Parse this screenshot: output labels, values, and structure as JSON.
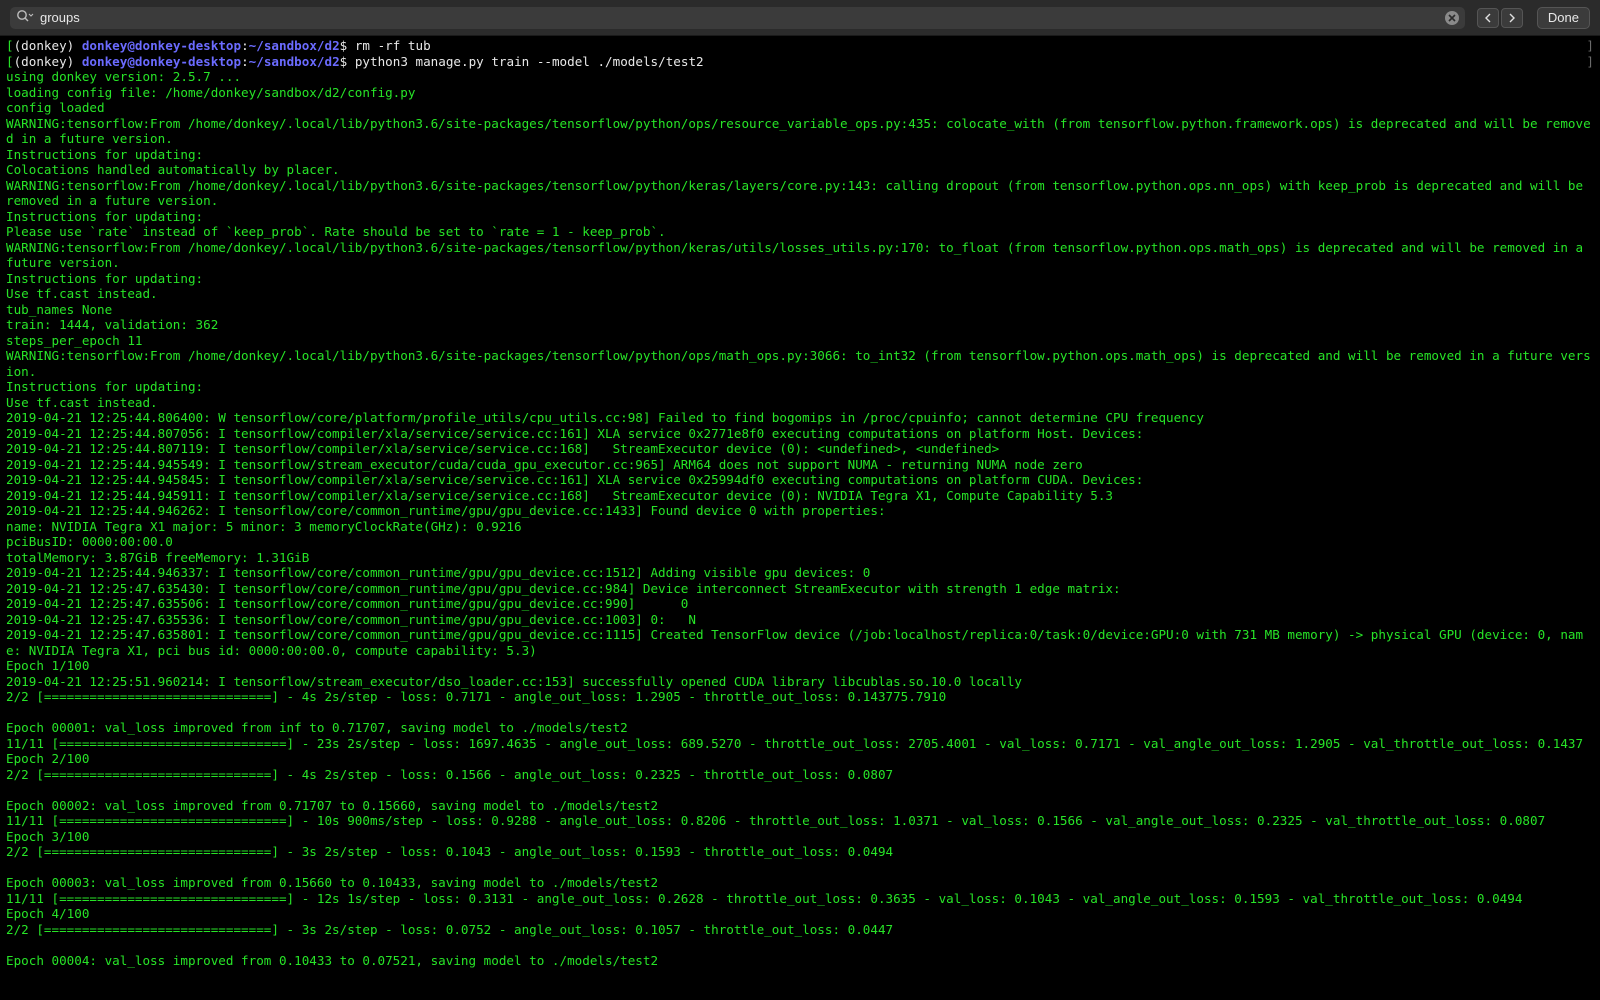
{
  "findbar": {
    "query": "groups",
    "done_label": "Done"
  },
  "terminal": {
    "prompts": [
      {
        "env": "(donkey) ",
        "user": "donkey@donkey-desktop",
        "sep": ":",
        "path": "~/sandbox/d2",
        "sym": "$ ",
        "cmd": "rm -rf tub"
      },
      {
        "env": "(donkey) ",
        "user": "donkey@donkey-desktop",
        "sep": ":",
        "path": "~/sandbox/d2",
        "sym": "$ ",
        "cmd": "python3 manage.py train --model ./models/test2"
      }
    ],
    "lines": [
      "using donkey version: 2.5.7 ...",
      "loading config file: /home/donkey/sandbox/d2/config.py",
      "config loaded",
      "WARNING:tensorflow:From /home/donkey/.local/lib/python3.6/site-packages/tensorflow/python/ops/resource_variable_ops.py:435: colocate_with (from tensorflow.python.framework.ops) is deprecated and will be removed in a future version.",
      "Instructions for updating:",
      "Colocations handled automatically by placer.",
      "WARNING:tensorflow:From /home/donkey/.local/lib/python3.6/site-packages/tensorflow/python/keras/layers/core.py:143: calling dropout (from tensorflow.python.ops.nn_ops) with keep_prob is deprecated and will be removed in a future version.",
      "Instructions for updating:",
      "Please use `rate` instead of `keep_prob`. Rate should be set to `rate = 1 - keep_prob`.",
      "WARNING:tensorflow:From /home/donkey/.local/lib/python3.6/site-packages/tensorflow/python/keras/utils/losses_utils.py:170: to_float (from tensorflow.python.ops.math_ops) is deprecated and will be removed in a future version.",
      "Instructions for updating:",
      "Use tf.cast instead.",
      "tub_names None",
      "train: 1444, validation: 362",
      "steps_per_epoch 11",
      "WARNING:tensorflow:From /home/donkey/.local/lib/python3.6/site-packages/tensorflow/python/ops/math_ops.py:3066: to_int32 (from tensorflow.python.ops.math_ops) is deprecated and will be removed in a future version.",
      "Instructions for updating:",
      "Use tf.cast instead.",
      "2019-04-21 12:25:44.806400: W tensorflow/core/platform/profile_utils/cpu_utils.cc:98] Failed to find bogomips in /proc/cpuinfo; cannot determine CPU frequency",
      "2019-04-21 12:25:44.807056: I tensorflow/compiler/xla/service/service.cc:161] XLA service 0x2771e8f0 executing computations on platform Host. Devices:",
      "2019-04-21 12:25:44.807119: I tensorflow/compiler/xla/service/service.cc:168]   StreamExecutor device (0): <undefined>, <undefined>",
      "2019-04-21 12:25:44.945549: I tensorflow/stream_executor/cuda/cuda_gpu_executor.cc:965] ARM64 does not support NUMA - returning NUMA node zero",
      "2019-04-21 12:25:44.945845: I tensorflow/compiler/xla/service/service.cc:161] XLA service 0x25994df0 executing computations on platform CUDA. Devices:",
      "2019-04-21 12:25:44.945911: I tensorflow/compiler/xla/service/service.cc:168]   StreamExecutor device (0): NVIDIA Tegra X1, Compute Capability 5.3",
      "2019-04-21 12:25:44.946262: I tensorflow/core/common_runtime/gpu/gpu_device.cc:1433] Found device 0 with properties:",
      "name: NVIDIA Tegra X1 major: 5 minor: 3 memoryClockRate(GHz): 0.9216",
      "pciBusID: 0000:00:00.0",
      "totalMemory: 3.87GiB freeMemory: 1.31GiB",
      "2019-04-21 12:25:44.946337: I tensorflow/core/common_runtime/gpu/gpu_device.cc:1512] Adding visible gpu devices: 0",
      "2019-04-21 12:25:47.635430: I tensorflow/core/common_runtime/gpu/gpu_device.cc:984] Device interconnect StreamExecutor with strength 1 edge matrix:",
      "2019-04-21 12:25:47.635506: I tensorflow/core/common_runtime/gpu/gpu_device.cc:990]      0",
      "2019-04-21 12:25:47.635536: I tensorflow/core/common_runtime/gpu/gpu_device.cc:1003] 0:   N",
      "2019-04-21 12:25:47.635801: I tensorflow/core/common_runtime/gpu/gpu_device.cc:1115] Created TensorFlow device (/job:localhost/replica:0/task:0/device:GPU:0 with 731 MB memory) -> physical GPU (device: 0, name: NVIDIA Tegra X1, pci bus id: 0000:00:00.0, compute capability: 5.3)",
      "Epoch 1/100",
      "2019-04-21 12:25:51.960214: I tensorflow/stream_executor/dso_loader.cc:153] successfully opened CUDA library libcublas.so.10.0 locally",
      "2/2 [==============================] - 4s 2s/step - loss: 0.7171 - angle_out_loss: 1.2905 - throttle_out_loss: 0.143775.7910",
      "",
      "Epoch 00001: val_loss improved from inf to 0.71707, saving model to ./models/test2",
      "11/11 [==============================] - 23s 2s/step - loss: 1697.4635 - angle_out_loss: 689.5270 - throttle_out_loss: 2705.4001 - val_loss: 0.7171 - val_angle_out_loss: 1.2905 - val_throttle_out_loss: 0.1437",
      "Epoch 2/100",
      "2/2 [==============================] - 4s 2s/step - loss: 0.1566 - angle_out_loss: 0.2325 - throttle_out_loss: 0.0807",
      "",
      "Epoch 00002: val_loss improved from 0.71707 to 0.15660, saving model to ./models/test2",
      "11/11 [==============================] - 10s 900ms/step - loss: 0.9288 - angle_out_loss: 0.8206 - throttle_out_loss: 1.0371 - val_loss: 0.1566 - val_angle_out_loss: 0.2325 - val_throttle_out_loss: 0.0807",
      "Epoch 3/100",
      "2/2 [==============================] - 3s 2s/step - loss: 0.1043 - angle_out_loss: 0.1593 - throttle_out_loss: 0.0494",
      "",
      "Epoch 00003: val_loss improved from 0.15660 to 0.10433, saving model to ./models/test2",
      "11/11 [==============================] - 12s 1s/step - loss: 0.3131 - angle_out_loss: 0.2628 - throttle_out_loss: 0.3635 - val_loss: 0.1043 - val_angle_out_loss: 0.1593 - val_throttle_out_loss: 0.0494",
      "Epoch 4/100",
      "2/2 [==============================] - 3s 2s/step - loss: 0.0752 - angle_out_loss: 0.1057 - throttle_out_loss: 0.0447",
      "",
      "Epoch 00004: val_loss improved from 0.10433 to 0.07521, saving model to ./models/test2"
    ]
  }
}
